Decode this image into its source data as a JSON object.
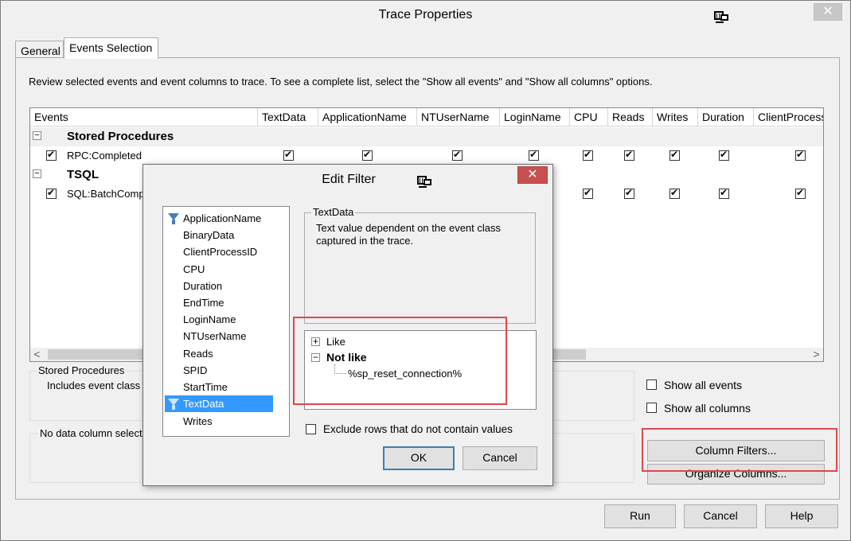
{
  "window": {
    "title": "Trace Properties",
    "close_glyph": "✕"
  },
  "tabs": [
    {
      "label": "General"
    },
    {
      "label": "Events Selection"
    }
  ],
  "instructions": "Review selected events and event columns to trace. To see a complete list, select the \"Show all events\" and \"Show all columns\" options.",
  "grid": {
    "columns": [
      "Events",
      "TextData",
      "ApplicationName",
      "NTUserName",
      "LoginName",
      "CPU",
      "Reads",
      "Writes",
      "Duration",
      "ClientProcess"
    ],
    "groups": [
      {
        "name": "Stored Procedures",
        "toggle": "−",
        "events": [
          {
            "name": "RPC:Completed"
          }
        ]
      },
      {
        "name": "TSQL",
        "toggle": "−",
        "events": [
          {
            "name": "SQL:BatchCompleted",
            "visible_name": "SQL:BatchComp"
          }
        ]
      }
    ],
    "scroll_left": "<",
    "scroll_right": ">"
  },
  "stored_proc_box": {
    "legend": "Stored Procedures",
    "text": "Includes event class"
  },
  "column_box": {
    "text": "No data column select"
  },
  "options": {
    "show_all_events": "Show all events",
    "show_all_columns": "Show all columns"
  },
  "buttons": {
    "column_filters": "Column Filters...",
    "organize_columns": "Organize Columns...",
    "run": "Run",
    "cancel": "Cancel",
    "help": "Help"
  },
  "dialog": {
    "title": "Edit Filter",
    "close_glyph": "✕",
    "columns": [
      "ApplicationName",
      "BinaryData",
      "ClientProcessID",
      "CPU",
      "Duration",
      "EndTime",
      "LoginName",
      "NTUserName",
      "Reads",
      "SPID",
      "StartTime",
      "TextData",
      "Writes"
    ],
    "selected_column": "TextData",
    "filtered_columns": [
      "ApplicationName",
      "TextData"
    ],
    "desc_legend": "TextData",
    "desc_text": "Text value dependent on the event class captured in the trace.",
    "tree": {
      "like": {
        "label": "Like",
        "toggle": "+"
      },
      "not_like": {
        "label": "Not like",
        "toggle": "−",
        "value": "%sp_reset_connection%"
      }
    },
    "exclude_label": "Exclude rows that do not contain values",
    "ok": "OK",
    "cancel": "Cancel"
  },
  "colors": {
    "highlight": "#e0474c",
    "selection": "#3399ff",
    "close_red": "#c75050"
  }
}
